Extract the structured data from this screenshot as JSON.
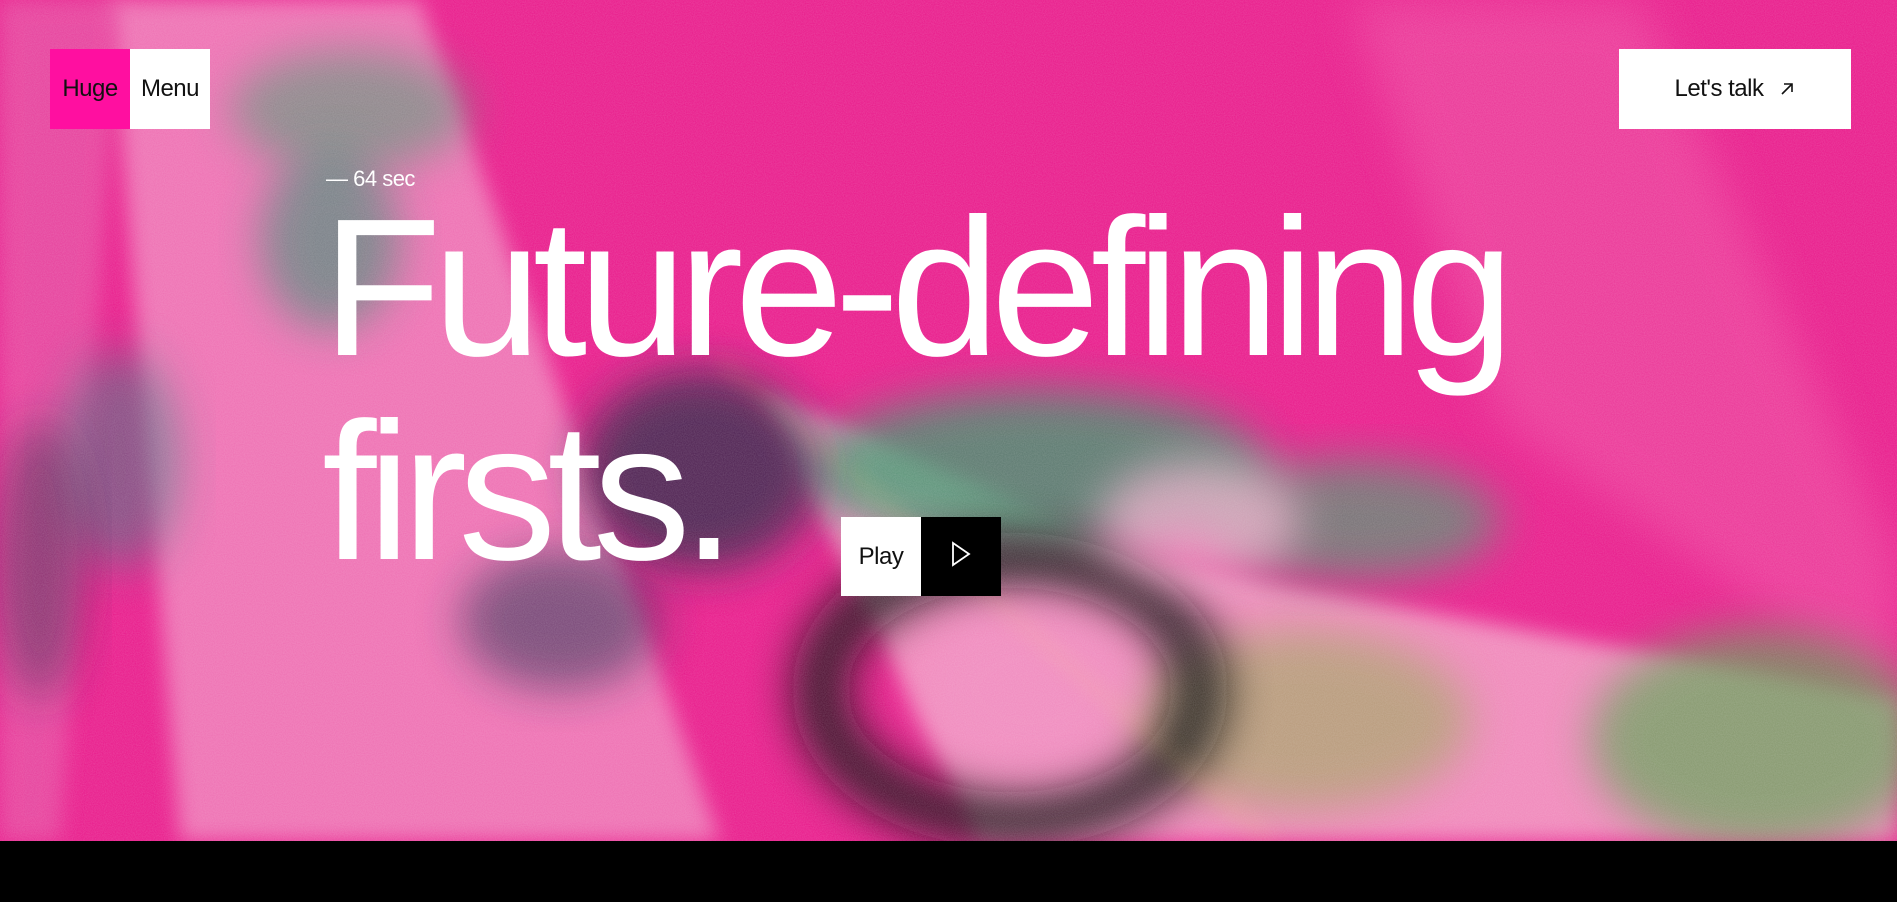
{
  "colors": {
    "brand_pink": "#ff0fa0",
    "hero_pink": "#e8198a",
    "white": "#ffffff",
    "black": "#000000"
  },
  "nav": {
    "logo_text": "Huge",
    "menu_label": "Menu",
    "cta_label": "Let's talk",
    "cta_icon": "arrow-up-right-icon"
  },
  "hero": {
    "duration": "— 64 sec",
    "headline_line1": "Future-defining",
    "headline_line2": "firsts.",
    "play_label": "Play",
    "play_icon": "play-triangle-icon"
  }
}
